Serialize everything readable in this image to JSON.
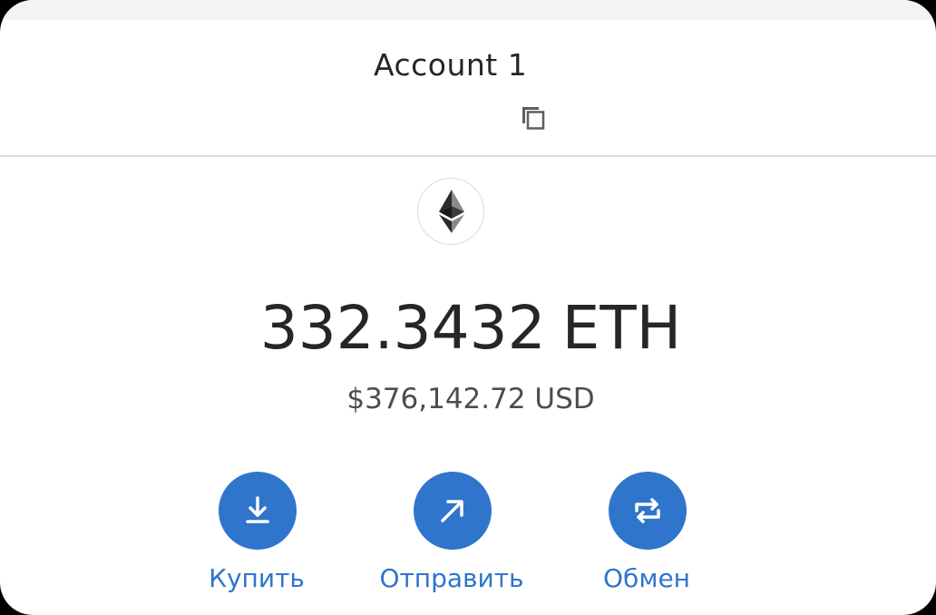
{
  "account": {
    "name": "Account 1",
    "copy_icon": "copy-icon"
  },
  "asset": {
    "logo_icon": "ethereum-icon",
    "balance_amount": "332.3432",
    "balance_unit": "ETH",
    "fiat_value": "$376,142.72 USD"
  },
  "actions": [
    {
      "label": "Купить",
      "icon": "download-icon"
    },
    {
      "label": "Отправить",
      "icon": "arrow-up-right-icon"
    },
    {
      "label": "Обмен",
      "icon": "swap-icon"
    }
  ],
  "colors": {
    "accent": "#2f75cc",
    "text_primary": "#24272a",
    "text_secondary": "#4a4e52",
    "divider": "#d8dadc",
    "top_strip": "#f2f3f4"
  }
}
